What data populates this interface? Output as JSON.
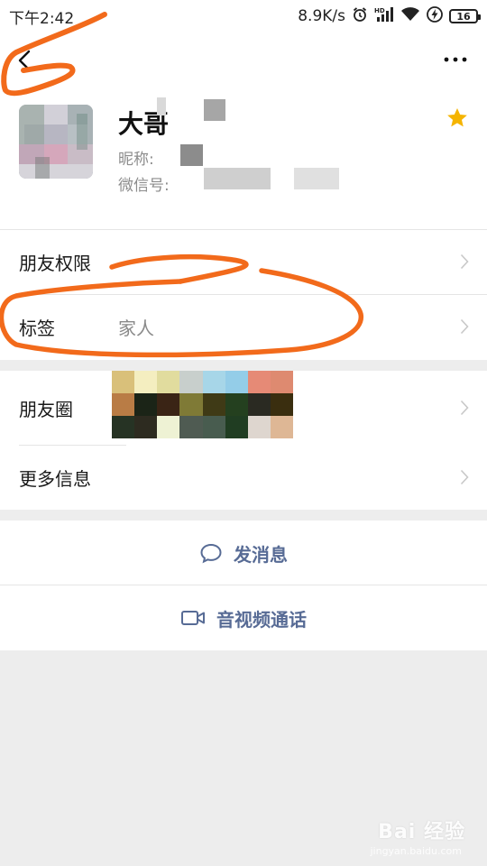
{
  "status_bar": {
    "time": "下午2:42",
    "network_speed": "8.9K/s",
    "battery_level": "16",
    "icons": [
      "alarm-icon",
      "hd-signal-icon",
      "wifi-icon",
      "charging-icon",
      "battery-icon"
    ]
  },
  "nav": {
    "back_icon": "chevron-left-icon",
    "more_icon": "more-dots-icon"
  },
  "profile": {
    "name": "大哥",
    "nickname_label": "昵称:",
    "wechat_id_label": "微信号:",
    "starred": true,
    "star_color": "#f5b400"
  },
  "rows": {
    "friend_permissions": {
      "label": "朋友权限"
    },
    "tags": {
      "label": "标签",
      "value": "家人"
    },
    "moments": {
      "label": "朋友圈"
    },
    "more_info": {
      "label": "更多信息"
    }
  },
  "actions": {
    "send_message": {
      "label": "发消息",
      "icon": "chat-bubble-icon"
    },
    "av_call": {
      "label": "音视频通话",
      "icon": "video-camera-icon"
    }
  },
  "colors": {
    "accent_link": "#576b95",
    "annotation_orange": "#f26a1b",
    "background": "#ededed"
  },
  "watermark": {
    "brand": "Bai 经验",
    "url": "jingyan.baidu.com"
  }
}
